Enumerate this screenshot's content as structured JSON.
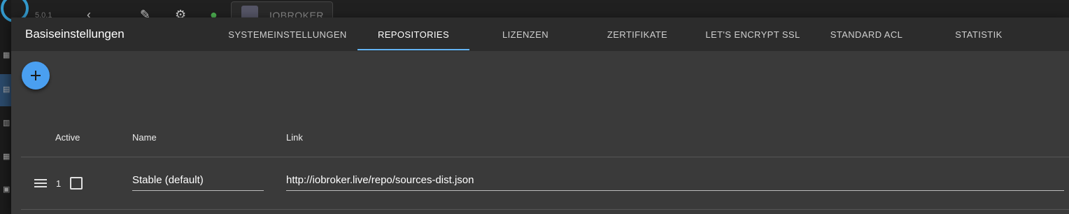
{
  "background": {
    "version_label": "5.0.1",
    "host_tab_label": "IOBROKER",
    "topbar_icons": [
      "wrench-icon",
      "gear-icon",
      "status-dot-icon"
    ]
  },
  "dialog": {
    "title": "Basiseinstellungen",
    "tabs": [
      {
        "label": "SYSTEMEINSTELLUNGEN",
        "active": false
      },
      {
        "label": "REPOSITORIES",
        "active": true
      },
      {
        "label": "LIZENZEN",
        "active": false
      },
      {
        "label": "ZERTIFIKATE",
        "active": false
      },
      {
        "label": "LET'S ENCRYPT SSL",
        "active": false
      },
      {
        "label": "STANDARD ACL",
        "active": false
      },
      {
        "label": "STATISTIK",
        "active": false
      }
    ],
    "accent_color": "#64b5f6",
    "add_button_icon": "plus-icon"
  },
  "table": {
    "columns": {
      "active": "Active",
      "name": "Name",
      "link": "Link"
    },
    "rows": [
      {
        "index": "1",
        "active": false,
        "name": "Stable (default)",
        "link": "http://iobroker.live/repo/sources-dist.json"
      }
    ]
  }
}
